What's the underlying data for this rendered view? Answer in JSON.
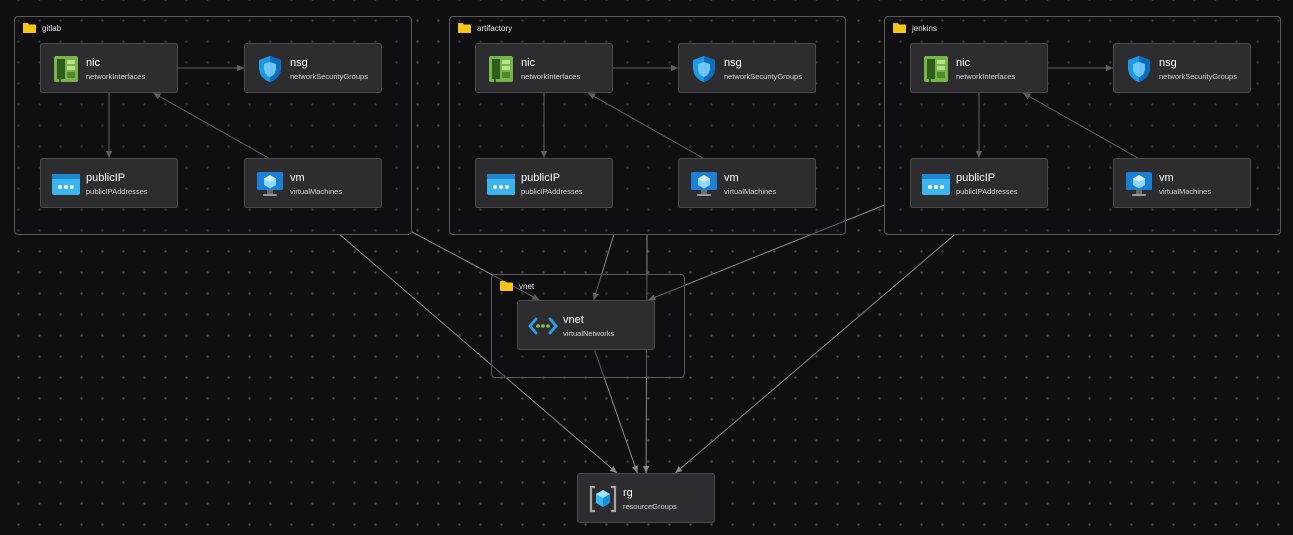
{
  "groups": {
    "gitlab": {
      "label": "gitlab"
    },
    "artifactory": {
      "label": "artifactory"
    },
    "jenkins": {
      "label": "jenkins"
    },
    "vnet": {
      "label": "vnet"
    }
  },
  "nodes": {
    "gitlab_nic": {
      "name": "nic",
      "type": "networkInterfaces",
      "icon": "nic-icon"
    },
    "gitlab_nsg": {
      "name": "nsg",
      "type": "networkSecurityGroups",
      "icon": "shield-icon"
    },
    "gitlab_pip": {
      "name": "publicIP",
      "type": "publicIPAddresses",
      "icon": "public-ip-icon"
    },
    "gitlab_vm": {
      "name": "vm",
      "type": "virtualMachines",
      "icon": "monitor-icon"
    },
    "artifactory_nic": {
      "name": "nic",
      "type": "networkInterfaces",
      "icon": "nic-icon"
    },
    "artifactory_nsg": {
      "name": "nsg",
      "type": "networkSecurityGroups",
      "icon": "shield-icon"
    },
    "artifactory_pip": {
      "name": "publicIP",
      "type": "publicIPAddresses",
      "icon": "public-ip-icon"
    },
    "artifactory_vm": {
      "name": "vm",
      "type": "virtualMachines",
      "icon": "monitor-icon"
    },
    "jenkins_nic": {
      "name": "nic",
      "type": "networkInterfaces",
      "icon": "nic-icon"
    },
    "jenkins_nsg": {
      "name": "nsg",
      "type": "networkSecurityGroups",
      "icon": "shield-icon"
    },
    "jenkins_pip": {
      "name": "publicIP",
      "type": "publicIPAddresses",
      "icon": "public-ip-icon"
    },
    "jenkins_vm": {
      "name": "vm",
      "type": "virtualMachines",
      "icon": "monitor-icon"
    },
    "vnet": {
      "name": "vnet",
      "type": "virtualNetworks",
      "icon": "vnet-icon"
    },
    "rg": {
      "name": "rg",
      "type": "resourceGroups",
      "icon": "resource-group-icon"
    }
  },
  "edges": [
    {
      "from": "gitlab_nic",
      "to": "gitlab_nsg"
    },
    {
      "from": "gitlab_nic",
      "to": "gitlab_pip"
    },
    {
      "from": "gitlab_vm",
      "to": "gitlab_nic"
    },
    {
      "from": "artifactory_nic",
      "to": "artifactory_nsg"
    },
    {
      "from": "artifactory_nic",
      "to": "artifactory_pip"
    },
    {
      "from": "artifactory_vm",
      "to": "artifactory_nic"
    },
    {
      "from": "jenkins_nic",
      "to": "jenkins_nsg"
    },
    {
      "from": "jenkins_nic",
      "to": "jenkins_pip"
    },
    {
      "from": "jenkins_vm",
      "to": "jenkins_nic"
    },
    {
      "from": "gitlab",
      "to": "vnet"
    },
    {
      "from": "artifactory",
      "to": "vnet"
    },
    {
      "from": "jenkins",
      "to": "vnet"
    },
    {
      "from": "gitlab",
      "to": "rg"
    },
    {
      "from": "artifactory",
      "to": "rg"
    },
    {
      "from": "jenkins",
      "to": "rg"
    },
    {
      "from": "vnet",
      "to": "rg"
    }
  ],
  "colors": {
    "background": "#0f0f10",
    "node_fill": "#2d2d2f",
    "border": "#5a5a5c",
    "edge": "#8a8a8a",
    "folder": "#f5c518",
    "azure_blue": "#1c9ae6",
    "nic_green": "#7ab34a"
  }
}
